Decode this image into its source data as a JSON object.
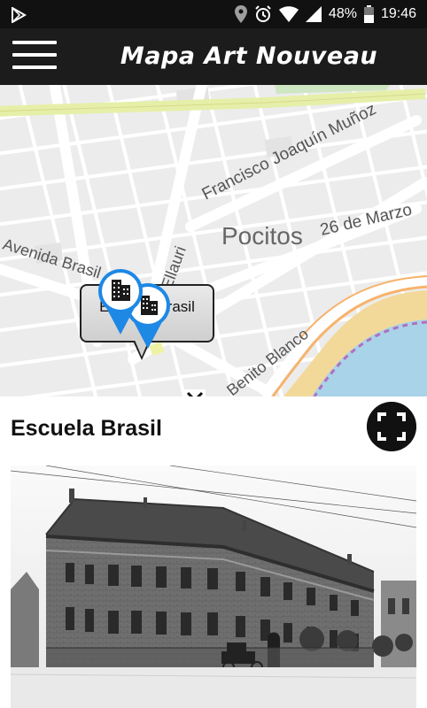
{
  "status_bar": {
    "battery": "48%",
    "time": "19:46"
  },
  "app_bar": {
    "title": "Mapa Art Nouveau"
  },
  "map": {
    "street_labels": [
      "Francisco Joaquín Muñoz",
      "26 de Marzo",
      "Pocitos",
      "Avenida Brasil",
      "Ellauri",
      "Benito Blanco"
    ],
    "callout": "Escuela Brasil"
  },
  "detail": {
    "title": "Escuela Brasil"
  },
  "colors": {
    "pin_blue": "#1e88e5",
    "app_bar": "#1c1c1c",
    "beach": "#f2d99a",
    "sea": "#a9d3e8",
    "major_road": "#e6efa8"
  }
}
